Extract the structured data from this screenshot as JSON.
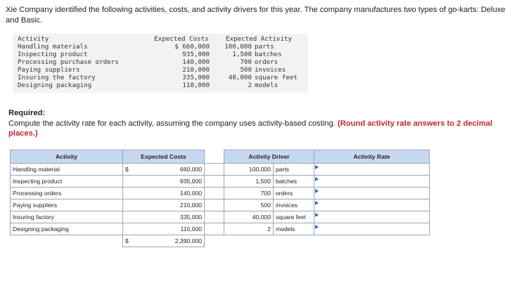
{
  "intro_text": "Xie Company identified the following activities, costs, and activity drivers for this year. The company manufactures two types of go-karts: Deluxe and Basic.",
  "data_box": {
    "header_activity": "Activity",
    "header_costs": "Expected Costs",
    "header_driver": "Expected Activity",
    "rows": [
      {
        "activity": "Handling materials",
        "cost": "$ 660,000",
        "qty": "100,000",
        "unit": "parts"
      },
      {
        "activity": "Inspecting product",
        "cost": "935,000",
        "qty": "1,500",
        "unit": "batches"
      },
      {
        "activity": "Processing purchase orders",
        "cost": "140,000",
        "qty": "700",
        "unit": "orders"
      },
      {
        "activity": "Paying suppliers",
        "cost": "210,000",
        "qty": "500",
        "unit": "invoices"
      },
      {
        "activity": "Insuring the factory",
        "cost": "335,000",
        "qty": "40,000",
        "unit": "square feet"
      },
      {
        "activity": "Designing packaging",
        "cost": "110,000",
        "qty": "2",
        "unit": "models"
      }
    ]
  },
  "required": {
    "title": "Required:",
    "text": "Compute the activity rate for each activity, assuming the company uses activity-based costing.",
    "emphasis": "(Round activity rate answers to 2 decimal places.)"
  },
  "table": {
    "headers": {
      "activity": "Activity",
      "costs": "Expected Costs",
      "driver": "Activity Driver",
      "rate": "Activity Rate"
    },
    "rows": [
      {
        "activity": "Handling material",
        "dollar": "$",
        "cost": "660,000",
        "qty": "100,000",
        "unit": "parts",
        "rate": ""
      },
      {
        "activity": "Inspecting product",
        "dollar": "",
        "cost": "935,000",
        "qty": "1,500",
        "unit": "batches",
        "rate": ""
      },
      {
        "activity": "Processing orders",
        "dollar": "",
        "cost": "140,000",
        "qty": "700",
        "unit": "orders",
        "rate": ""
      },
      {
        "activity": "Paying suppliers",
        "dollar": "",
        "cost": "210,000",
        "qty": "500",
        "unit": "invoices",
        "rate": ""
      },
      {
        "activity": "Insuring factory",
        "dollar": "",
        "cost": "335,000",
        "qty": "40,000",
        "unit": "square feet",
        "rate": ""
      },
      {
        "activity": "Designing packaging",
        "dollar": "",
        "cost": "110,000",
        "qty": "2",
        "unit": "models",
        "rate": ""
      }
    ],
    "total": {
      "dollar": "$",
      "cost": "2,390,000"
    }
  },
  "colors": {
    "header_bg": "#c6d9f1",
    "emphasis": "#c0282d",
    "arrow": "#2a66b4",
    "box_bg": "#f2f2f2"
  }
}
